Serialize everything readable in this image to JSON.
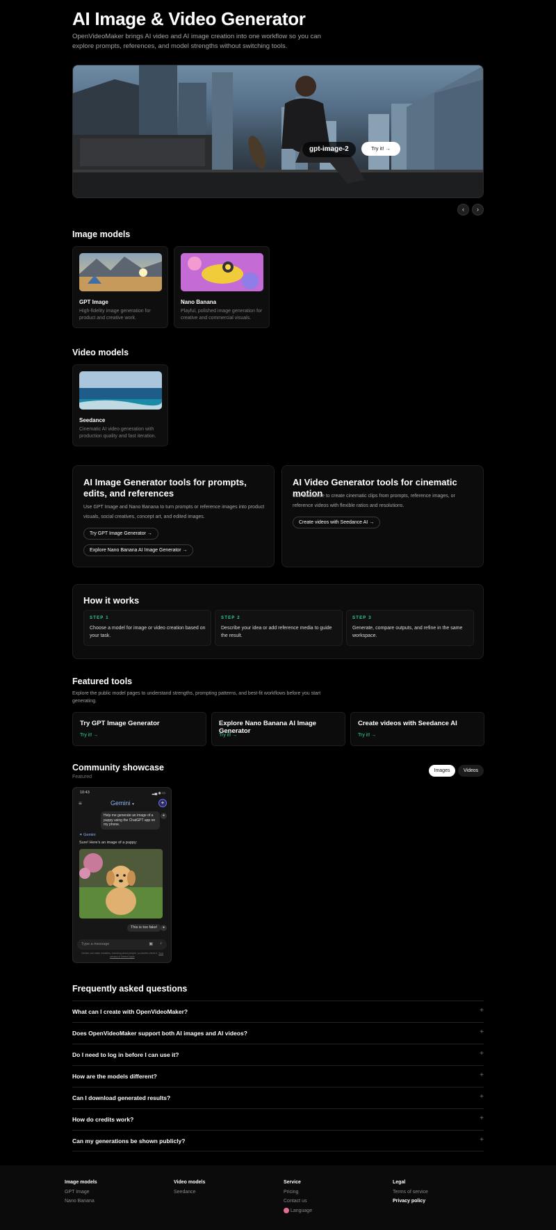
{
  "hero": {
    "title": "AI Image & Video Generator",
    "subtitle": "OpenVideoMaker brings AI video and AI image creation into one workflow so you can explore prompts, references, and model strengths without switching tools."
  },
  "banner": {
    "model_label": "gpt-image-2",
    "try_label": "Try it!",
    "arrow": "→",
    "prev": "‹",
    "next": "›"
  },
  "image_models": {
    "title": "Image models",
    "items": [
      {
        "name": "GPT Image",
        "desc": "High-fidelity image generation for product and creative work."
      },
      {
        "name": "Nano Banana",
        "desc": "Playful, polished image generation for creative and commercial visuals."
      }
    ]
  },
  "video_models": {
    "title": "Video models",
    "items": [
      {
        "name": "Seedance",
        "desc": "Cinematic AI video generation with production quality and fast iteration."
      }
    ]
  },
  "image_tools": {
    "title": "AI Image Generator tools for prompts, edits, and references",
    "text": "Use GPT Image and Nano Banana to turn prompts or reference images into product visuals, social creatives, concept art, and edited images.",
    "btn1": "Try GPT Image Generator",
    "btn2": "Explore Nano Banana AI Image Generator"
  },
  "video_tools": {
    "title": "AI Video Generator tools for cinematic motion",
    "text": "Use Seedance to create cinematic clips from prompts, reference images, or reference videos with flexible ratios and resolutions.",
    "btn1": "Create videos with Seedance AI"
  },
  "how": {
    "title": "How it works",
    "steps": [
      {
        "label": "STEP 1",
        "text": "Choose a model for image or video creation based on your task."
      },
      {
        "label": "STEP 2",
        "text": "Describe your idea or add reference media to guide the result."
      },
      {
        "label": "STEP 3",
        "text": "Generate, compare outputs, and refine in the same workspace."
      }
    ]
  },
  "featured": {
    "title": "Featured tools",
    "subtitle": "Explore the public model pages to understand strengths, prompting patterns, and best-fit workflows before you start generating.",
    "try_label": "Try it! →",
    "tools": [
      "Try GPT Image Generator",
      "Explore Nano Banana AI Image Generator",
      "Create videos with Seedance AI"
    ]
  },
  "showcase": {
    "title": "Community showcase",
    "subtitle": "Featured",
    "tab_images": "Images",
    "tab_videos": "Videos",
    "phone": {
      "time": "10:43",
      "app": "Gemini",
      "user_msg": "Help me generate an image of a puppy using the ChatGPT app on my phone.",
      "bot_name": "Gemini",
      "bot_msg": "Sure! Here's an image of a puppy:",
      "reply": "This is too fake!",
      "input_placeholder": "Type a message",
      "disclaimer": "Gemini can make mistakes, including about people, so double-check it.",
      "privacy_link": "Your privacy & Gemini Apps"
    }
  },
  "faq": {
    "title": "Frequently asked questions",
    "plus": "+",
    "items": [
      "What can I create with OpenVideoMaker?",
      "Does OpenVideoMaker support both AI images and AI videos?",
      "Do I need to log in before I can use it?",
      "How are the models different?",
      "Can I download generated results?",
      "How do credits work?",
      "Can my generations be shown publicly?"
    ]
  },
  "footer": {
    "image_models": {
      "title": "Image models",
      "links": [
        "GPT Image",
        "Nano Banana"
      ]
    },
    "video_models": {
      "title": "Video models",
      "links": [
        "Seedance"
      ]
    },
    "service": {
      "title": "Service",
      "links": [
        "Pricing",
        "Contact us",
        "Language"
      ]
    },
    "legal": {
      "title": "Legal",
      "links": [
        "Terms of service",
        "Privacy policy"
      ]
    }
  },
  "colors": {
    "accent_green": "#34d399",
    "bg": "#000000",
    "card": "#0c0c0c"
  }
}
